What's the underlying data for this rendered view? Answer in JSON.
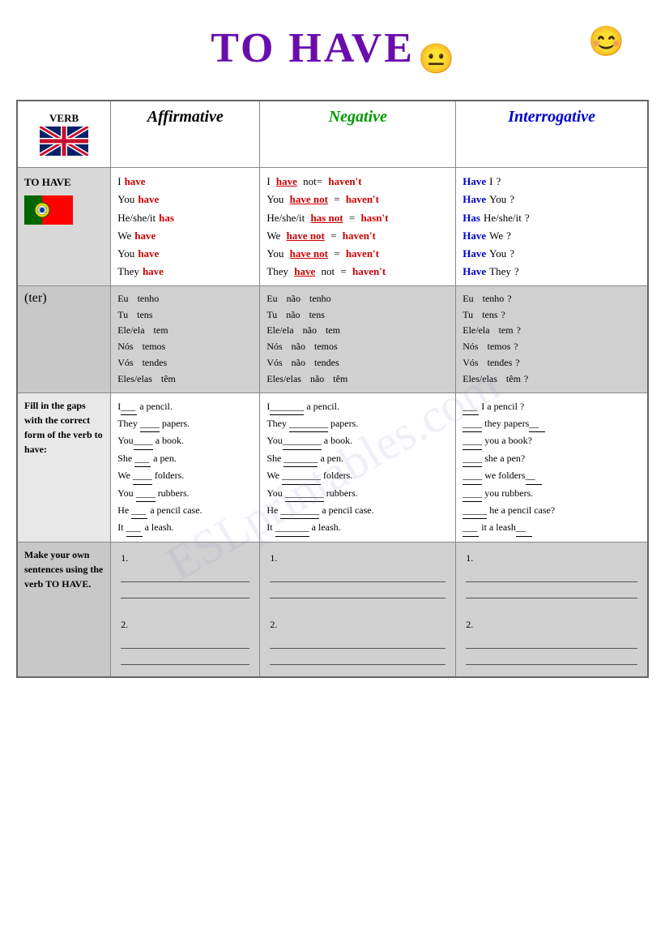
{
  "title": "TO HAVE",
  "emoji1": "😐",
  "emoji2": "😊",
  "header": {
    "verb_col": "VERB",
    "affirmative": "Affirmative",
    "negative": "Negative",
    "interrogative": "Interrogative"
  },
  "english_conjugation": {
    "affirmative": [
      {
        "pronoun": "I",
        "verb": "have"
      },
      {
        "pronoun": "You",
        "verb": "have"
      },
      {
        "pronoun": "He/she/it",
        "verb": "has"
      },
      {
        "pronoun": "We",
        "verb": "have"
      },
      {
        "pronoun": "You",
        "verb": "have"
      },
      {
        "pronoun": "They",
        "verb": "have"
      }
    ],
    "negative": [
      {
        "pronoun": "I",
        "verb": "have",
        "not": "not=",
        "contraction": "haven't"
      },
      {
        "pronoun": "You",
        "verb": "have not",
        "eq": "=",
        "contraction": "haven't"
      },
      {
        "pronoun": "He/she/it",
        "verb": "has not",
        "eq": "=",
        "contraction": "hasn't"
      },
      {
        "pronoun": "We",
        "verb": "have not",
        "eq": "=",
        "contraction": "haven't"
      },
      {
        "pronoun": "You",
        "verb": "have not",
        "eq": "=",
        "contraction": "haven't"
      },
      {
        "pronoun": "They",
        "verb": "have",
        "not": "not",
        "eq": "=",
        "contraction": "haven't"
      }
    ],
    "interrogative": [
      {
        "verb": "Have",
        "pronoun": "I",
        "q": "?"
      },
      {
        "verb": "Have",
        "pronoun": "You",
        "q": "?"
      },
      {
        "verb": "Has",
        "pronoun": "He/she/it",
        "q": "?"
      },
      {
        "verb": "Have",
        "pronoun": "We",
        "q": "?"
      },
      {
        "verb": "Have",
        "pronoun": "You",
        "q": "?"
      },
      {
        "verb": "Have",
        "pronoun": "They",
        "q": "?"
      }
    ]
  },
  "verb_label": "TO HAVE",
  "ter_label": "(ter)",
  "portuguese_conjugation": {
    "affirmative": [
      {
        "pronoun": "Eu",
        "verb": "tenho"
      },
      {
        "pronoun": "Tu",
        "verb": "tens"
      },
      {
        "pronoun": "Ele/ela",
        "verb": "tem"
      },
      {
        "pronoun": "Nós",
        "verb": "temos"
      },
      {
        "pronoun": "Vós",
        "verb": "tendes"
      },
      {
        "pronoun": "Eles/elas",
        "verb": "têm"
      }
    ],
    "negative": [
      {
        "pronoun": "Eu",
        "neg": "não",
        "verb": "tenho"
      },
      {
        "pronoun": "Tu",
        "neg": "não",
        "verb": "tens"
      },
      {
        "pronoun": "Ele/ela",
        "neg": "não",
        "verb": "tem"
      },
      {
        "pronoun": "Nós",
        "neg": "não",
        "verb": "temos"
      },
      {
        "pronoun": "Vós",
        "neg": "não",
        "verb": "tendes"
      },
      {
        "pronoun": "Eles/elas",
        "neg": "não",
        "verb": "têm"
      }
    ],
    "interrogative": [
      {
        "pronoun": "Eu",
        "verb": "tenho",
        "q": "?"
      },
      {
        "pronoun": "Tu",
        "verb": "tens",
        "q": "?"
      },
      {
        "pronoun": "Ele/ela",
        "verb": "tem",
        "q": "?"
      },
      {
        "pronoun": "Nós",
        "verb": "temos",
        "q": "?"
      },
      {
        "pronoun": "Vós",
        "verb": "tendes",
        "q": " ?"
      },
      {
        "pronoun": "Eles/elas",
        "verb": "têm",
        "q": " ?"
      }
    ]
  },
  "fill_label": "Fill in the gaps with the correct form of the verb to have:",
  "fill_affirmative": [
    "I___ a pencil.",
    "They ____ papers.",
    "You____ a book.",
    "She ___ a pen.",
    "We ____ folders.",
    "You ____ rubbers.",
    "He ___ a pencil case.",
    "It ___ a leash."
  ],
  "fill_negative": [
    "I_______ a pencil.",
    "They ________ papers.",
    "You________ a book.",
    "She _______ a pen.",
    "We ________ folders.",
    "You ________ rubbers.",
    "He ________ a pencil case.",
    "It _______ a leash."
  ],
  "fill_interrogative": [
    "___ I a pencil ?",
    "____ they papers__",
    "____ you a book?",
    "____ she a pen?",
    "____ we folders__",
    "____ you rubbers.",
    "_____ he a pencil case?",
    "___ it a leash__"
  ],
  "make_label": "Make your own sentences using the verb TO HAVE.",
  "watermark": "ESLprintables.com"
}
